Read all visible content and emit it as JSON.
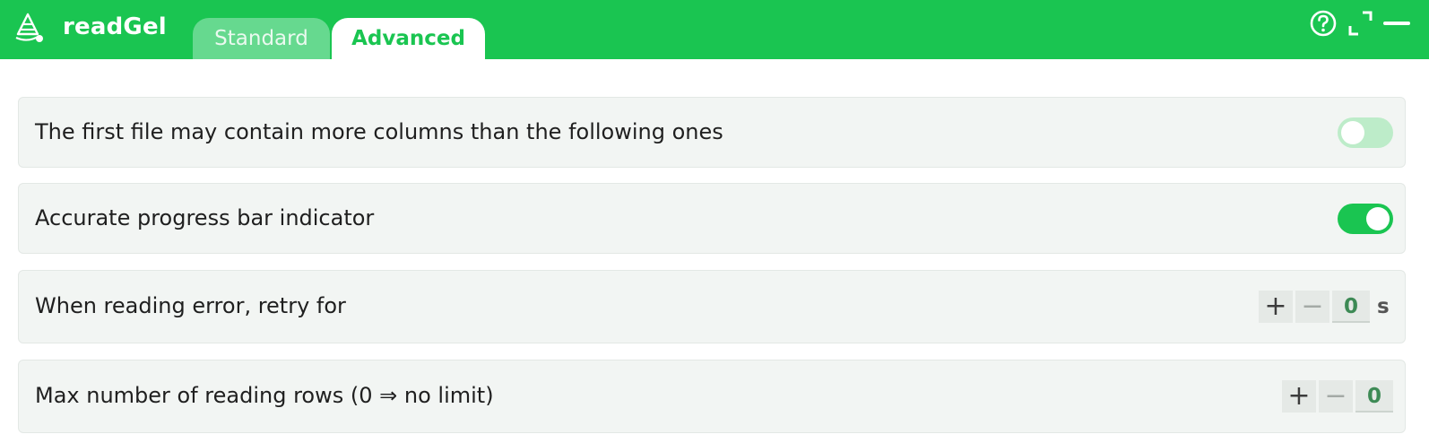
{
  "app": {
    "title": "readGel"
  },
  "tabs": [
    {
      "label": "Standard",
      "active": false
    },
    {
      "label": "Advanced",
      "active": true
    }
  ],
  "window_controls": {
    "icons": [
      "help-icon",
      "expand-icon",
      "minimize-icon"
    ]
  },
  "colors": {
    "brand_green": "#1ac551",
    "row_background": "#f2f5f3",
    "value_green": "#3d8a55"
  },
  "settings": {
    "first_file_columns": {
      "label": "The first file may contain more columns than the following ones",
      "enabled": false
    },
    "accurate_progress": {
      "label": "Accurate progress bar indicator",
      "enabled": true
    },
    "retry": {
      "label": "When reading error, retry for",
      "plus": "+",
      "minus": "−",
      "value": "0",
      "unit": "s"
    },
    "max_rows": {
      "label": "Max number of reading rows (0 ⇒ no limit)",
      "plus": "+",
      "minus": "−",
      "value": "0"
    }
  }
}
